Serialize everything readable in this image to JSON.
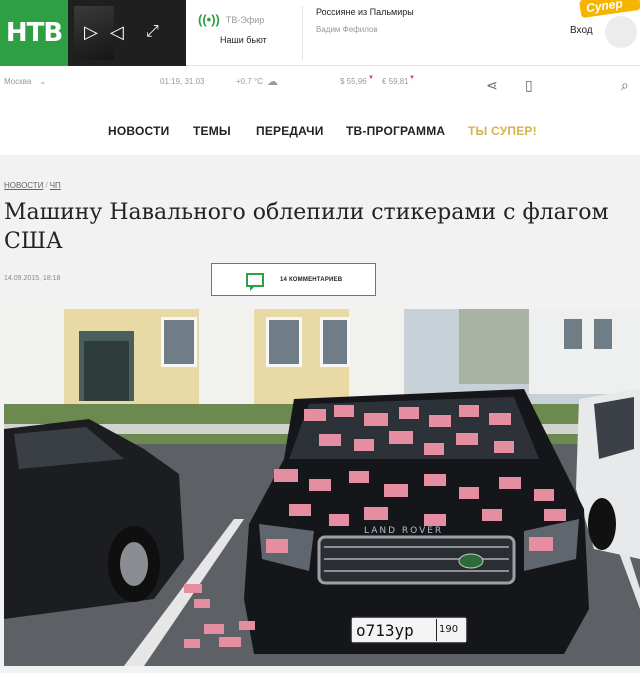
{
  "header": {
    "logo_text": "НТВ",
    "live_label": "ТВ-Эфир",
    "live_title": "Наши бьют",
    "feature_title": "Россияне из Пальмиры",
    "feature_author": "Вадим Фефилов",
    "promo_badge": "Супер",
    "login_label": "Вход"
  },
  "infobar": {
    "city": "Москва",
    "time": "01:19, 31.03",
    "temperature": "+0.7 °C",
    "usd": "$ 55,96",
    "eur": "€ 59,81",
    "indicator_down_color": "#e53935"
  },
  "nav": {
    "items": [
      "НОВОСТИ",
      "ТЕМЫ",
      "ПЕРЕДАЧИ",
      "ТВ-ПРОГРАММА",
      "ТЫ СУПЕР!"
    ]
  },
  "article": {
    "breadcrumbs": [
      "НОВОСТИ",
      "ЧП"
    ],
    "headline": "Машину Навального облепили стикерами с флагом США",
    "date": "14.09.2015, 18:18",
    "comments_label": "14 КОММЕНТАРИЕВ",
    "plate_number": "о713ур",
    "plate_region": "190",
    "car_badge": "LAND ROVER"
  },
  "colors": {
    "brand_green": "#2ea043",
    "promo_gold": "#d8b24a"
  }
}
